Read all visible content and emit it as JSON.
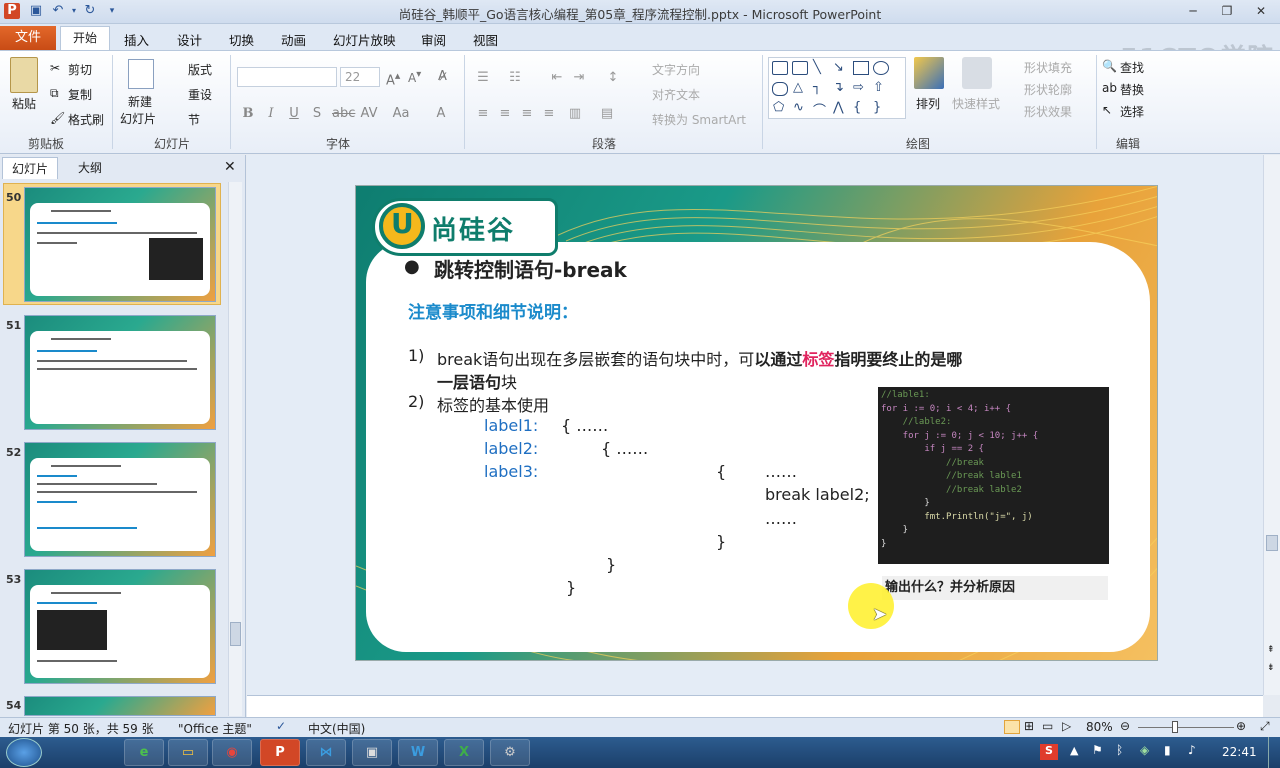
{
  "window": {
    "title": "尚硅谷_韩顺平_Go语言核心编程_第05章_程序流程控制.pptx - Microsoft PowerPoint",
    "watermark": "51CTO学院"
  },
  "menu": {
    "file": "文件",
    "tabs": [
      "开始",
      "插入",
      "设计",
      "切换",
      "动画",
      "幻灯片放映",
      "审阅",
      "视图"
    ]
  },
  "ribbon": {
    "clipboard": {
      "paste": "粘贴",
      "cut": "剪切",
      "copy": "复制",
      "format_painter": "格式刷",
      "group": "剪贴板"
    },
    "slides": {
      "new_slide_1": "新建",
      "new_slide_2": "幻灯片",
      "layout": "版式",
      "reset": "重设",
      "section": "节",
      "group": "幻灯片"
    },
    "font": {
      "size": "22",
      "group": "字体"
    },
    "paragraph": {
      "text_direction": "文字方向",
      "align_text": "对齐文本",
      "smartart": "转换为 SmartArt",
      "group": "段落"
    },
    "drawing": {
      "arrange": "排列",
      "quick_styles": "快速样式",
      "shape_fill": "形状填充",
      "shape_outline": "形状轮廓",
      "shape_effects": "形状效果",
      "group": "绘图"
    },
    "editing": {
      "find": "查找",
      "replace": "替换",
      "select": "选择",
      "group": "编辑"
    }
  },
  "panel": {
    "tab_slides": "幻灯片",
    "tab_outline": "大纲",
    "thumbs": [
      {
        "num": "50",
        "selected": true
      },
      {
        "num": "51",
        "selected": false
      },
      {
        "num": "52",
        "selected": false
      },
      {
        "num": "53",
        "selected": false
      },
      {
        "num": "54",
        "selected": false
      }
    ]
  },
  "slide": {
    "logo": "尚硅谷",
    "heading": "跳转控制语句-break",
    "subheading": "注意事项和细节说明：",
    "item1_num": "1)",
    "item1_a": "break语句出现在多层嵌套的语句块中时，可",
    "item1_b": "以通过",
    "item1_c": "标签",
    "item1_d": "指明要终止的是哪",
    "item1_line2": "一层语句",
    "item1_line2_end": "块",
    "item2_num": "2)",
    "item2": "标签的基本使用",
    "label1": "label1:",
    "label2": "label2:",
    "label3": "label3:",
    "brace_open_1": "{   ……",
    "brace_open_2": "{   ……",
    "brace_open_3": "{",
    "dots_1": "……",
    "break_stmt": "break label2;",
    "dots_2": "……",
    "brace_close": "}",
    "question": "输出什么？并分析原因",
    "code": [
      "//lable1:",
      "for i := 0; i < 4; i++ {",
      "    //lable2:",
      "    for j := 0; j < 10; j++ {",
      "        if j == 2 {",
      "            //break",
      "            //break lable1",
      "            //break lable2",
      "        }",
      "        fmt.Println(\"j=\", j)",
      "    }",
      "}"
    ]
  },
  "status": {
    "slide_info": "幻灯片 第 50 张，共 59 张",
    "theme": "\"Office 主题\"",
    "language": "中文(中国)",
    "zoom": "80%"
  },
  "taskbar": {
    "clock": "22:41"
  },
  "colors": {
    "accent_file": "#d55a1f",
    "label_blue": "#1f6fc2",
    "highlight_red": "#e0245e",
    "sub_blue": "#1a8acb"
  }
}
